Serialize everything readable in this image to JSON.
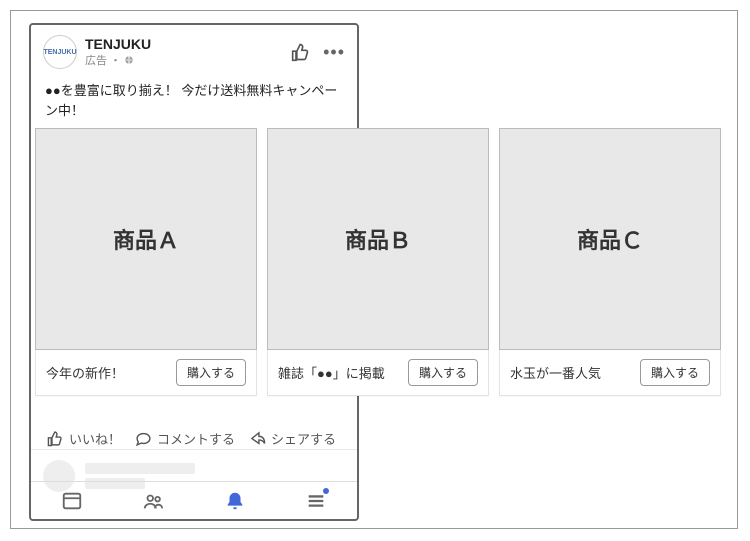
{
  "header": {
    "avatar_text": "TENJUKU",
    "page_name": "TENJUKU",
    "meta_label": "広告",
    "meta_sep": "・"
  },
  "post": {
    "body": "●●を豊富に取り揃え！ 今だけ送料無料キャンペーン中！"
  },
  "cards": [
    {
      "title": "商品Ａ",
      "caption": "今年の新作！",
      "cta": "購入する"
    },
    {
      "title": "商品Ｂ",
      "caption": "雑誌「●●」に掲載",
      "cta": "購入する"
    },
    {
      "title": "商品Ｃ",
      "caption": "水玉が一番人気",
      "cta": "購入する"
    }
  ],
  "actions": {
    "like": "いいね！",
    "comment": "コメントする",
    "share": "シェアする"
  }
}
